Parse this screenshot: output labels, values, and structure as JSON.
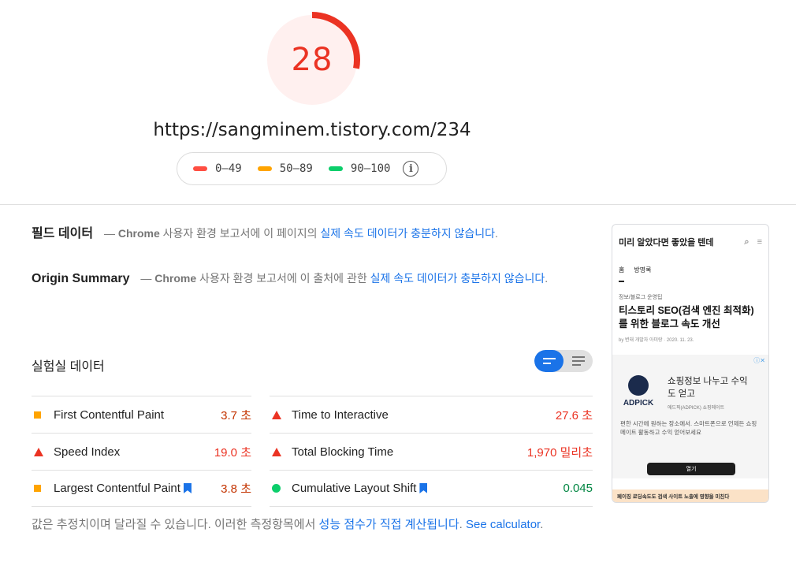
{
  "score": {
    "value": "28",
    "fraction": 0.28,
    "color": "#eb3323",
    "bg_color": "#fff0ef"
  },
  "url": "https://sangminem.tistory.com/234",
  "legend": {
    "ranges": [
      {
        "label": "0–49",
        "color": "#ff4e42"
      },
      {
        "label": "50–89",
        "color": "#ffa400"
      },
      {
        "label": "90–100",
        "color": "#0cce6b"
      }
    ],
    "info_icon": "info-icon",
    "info_glyph": "i"
  },
  "field_data": {
    "title": "필드 데이터",
    "dash": "—",
    "brand": "Chrome",
    "text": " 사용자 환경 보고서에 이 페이지의 ",
    "link": "실제 속도 데이터가 충분하지 않습니다",
    "end": "."
  },
  "origin_summary": {
    "title": "Origin Summary",
    "dash": "—",
    "brand": "Chrome",
    "text": " 사용자 환경 보고서에 이 출처에 관한 ",
    "link": "실제 속도 데이터가 충분하지 않습니다",
    "end": "."
  },
  "lab_data": {
    "title": "실험실 데이터",
    "view_toggle": {
      "active": "summary-view",
      "icons": [
        "summary-view-icon",
        "list-view-icon"
      ]
    },
    "metrics_left": [
      {
        "name": "First Contentful Paint",
        "value": "3.7 초",
        "status": "average",
        "icon": "square-icon",
        "bookmark": false
      },
      {
        "name": "Speed Index",
        "value": "19.0 초",
        "status": "fail",
        "icon": "triangle-icon",
        "bookmark": false
      },
      {
        "name": "Largest Contentful Paint",
        "value": "3.8 초",
        "status": "average",
        "icon": "square-icon",
        "bookmark": true
      }
    ],
    "metrics_right": [
      {
        "name": "Time to Interactive",
        "value": "27.6 초",
        "status": "fail",
        "icon": "triangle-icon",
        "bookmark": false
      },
      {
        "name": "Total Blocking Time",
        "value": "1,970 밀리초",
        "status": "fail",
        "icon": "triangle-icon",
        "bookmark": false
      },
      {
        "name": "Cumulative Layout Shift",
        "value": "0.045",
        "status": "pass",
        "icon": "circle-icon",
        "bookmark": true
      }
    ]
  },
  "footnote": {
    "text": "값은 추정치이며 달라질 수 있습니다. 이러한 측정항목에서 ",
    "link": "성능 점수가 직접 계산됩니다",
    "link2": "See calculator",
    "end": "."
  },
  "thumbnail": {
    "header": "미리 알았다면 좋았을 텐데",
    "header_icons": [
      "search-icon",
      "menu-icon"
    ],
    "tabs": [
      "홈",
      "방명록"
    ],
    "category": "정보/블로그 운영팁",
    "title": "티스토리 SEO(검색 엔진 최적화)를 위한 블로그 속도 개선",
    "meta": "by 변태 개발자 아미랑 · 2020. 11. 23.",
    "ad": {
      "badge": "ⓘ✕",
      "brand": "ADPICK",
      "headline": "쇼핑정보 나누고 수익도 얻고",
      "sub": "애드픽(ADPICK) 쇼핑메이트",
      "body": "편한 시간에 원하는 장소에서. 스마트폰으로 언제든 쇼핑메이트 활동하고 수익 얻어보세요",
      "cta": "열기"
    },
    "footer": "페이징 로딩속도도 검색 사이트 노출에 영향을 미친다"
  }
}
